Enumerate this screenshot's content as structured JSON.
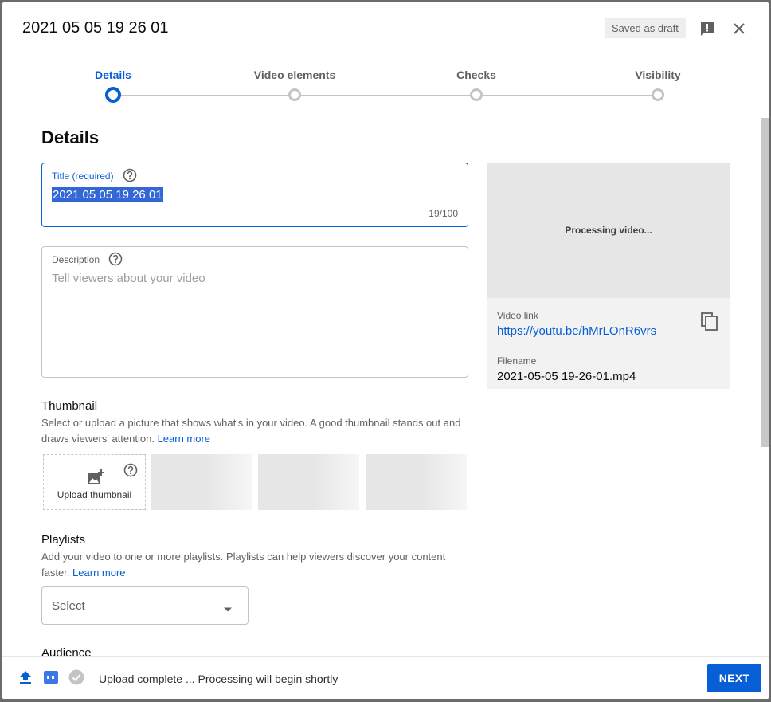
{
  "dialog": {
    "title": "2021 05 05 19 26 01",
    "draft_badge": "Saved as draft"
  },
  "stepper": {
    "steps": [
      {
        "label": "Details",
        "active": true
      },
      {
        "label": "Video elements",
        "active": false
      },
      {
        "label": "Checks",
        "active": false
      },
      {
        "label": "Visibility",
        "active": false
      }
    ]
  },
  "details": {
    "heading": "Details",
    "title_field": {
      "label": "Title (required)",
      "value": "2021 05 05 19 26 01",
      "counter": "19/100"
    },
    "description_field": {
      "label": "Description",
      "placeholder": "Tell viewers about your video"
    },
    "thumbnail": {
      "heading": "Thumbnail",
      "description": "Select or upload a picture that shows what's in your video. A good thumbnail stands out and draws viewers' attention.",
      "learn_more": "Learn more",
      "upload_label": "Upload thumbnail"
    },
    "playlists": {
      "heading": "Playlists",
      "description": "Add your video to one or more playlists. Playlists can help viewers discover your content faster.",
      "learn_more": "Learn more",
      "select_placeholder": "Select"
    },
    "audience": {
      "heading": "Audience"
    }
  },
  "preview": {
    "processing_text": "Processing video...",
    "video_link_label": "Video link",
    "video_link": "https://youtu.be/hMrLOnR6vrs",
    "filename_label": "Filename",
    "filename": "2021-05-05 19-26-01.mp4"
  },
  "footer": {
    "status": "Upload complete ... Processing will begin shortly",
    "next_label": "NEXT"
  },
  "colors": {
    "accent": "#065fd4",
    "text_primary": "#0d0d0d",
    "text_secondary": "#606060",
    "border": "#c4c4c4"
  }
}
